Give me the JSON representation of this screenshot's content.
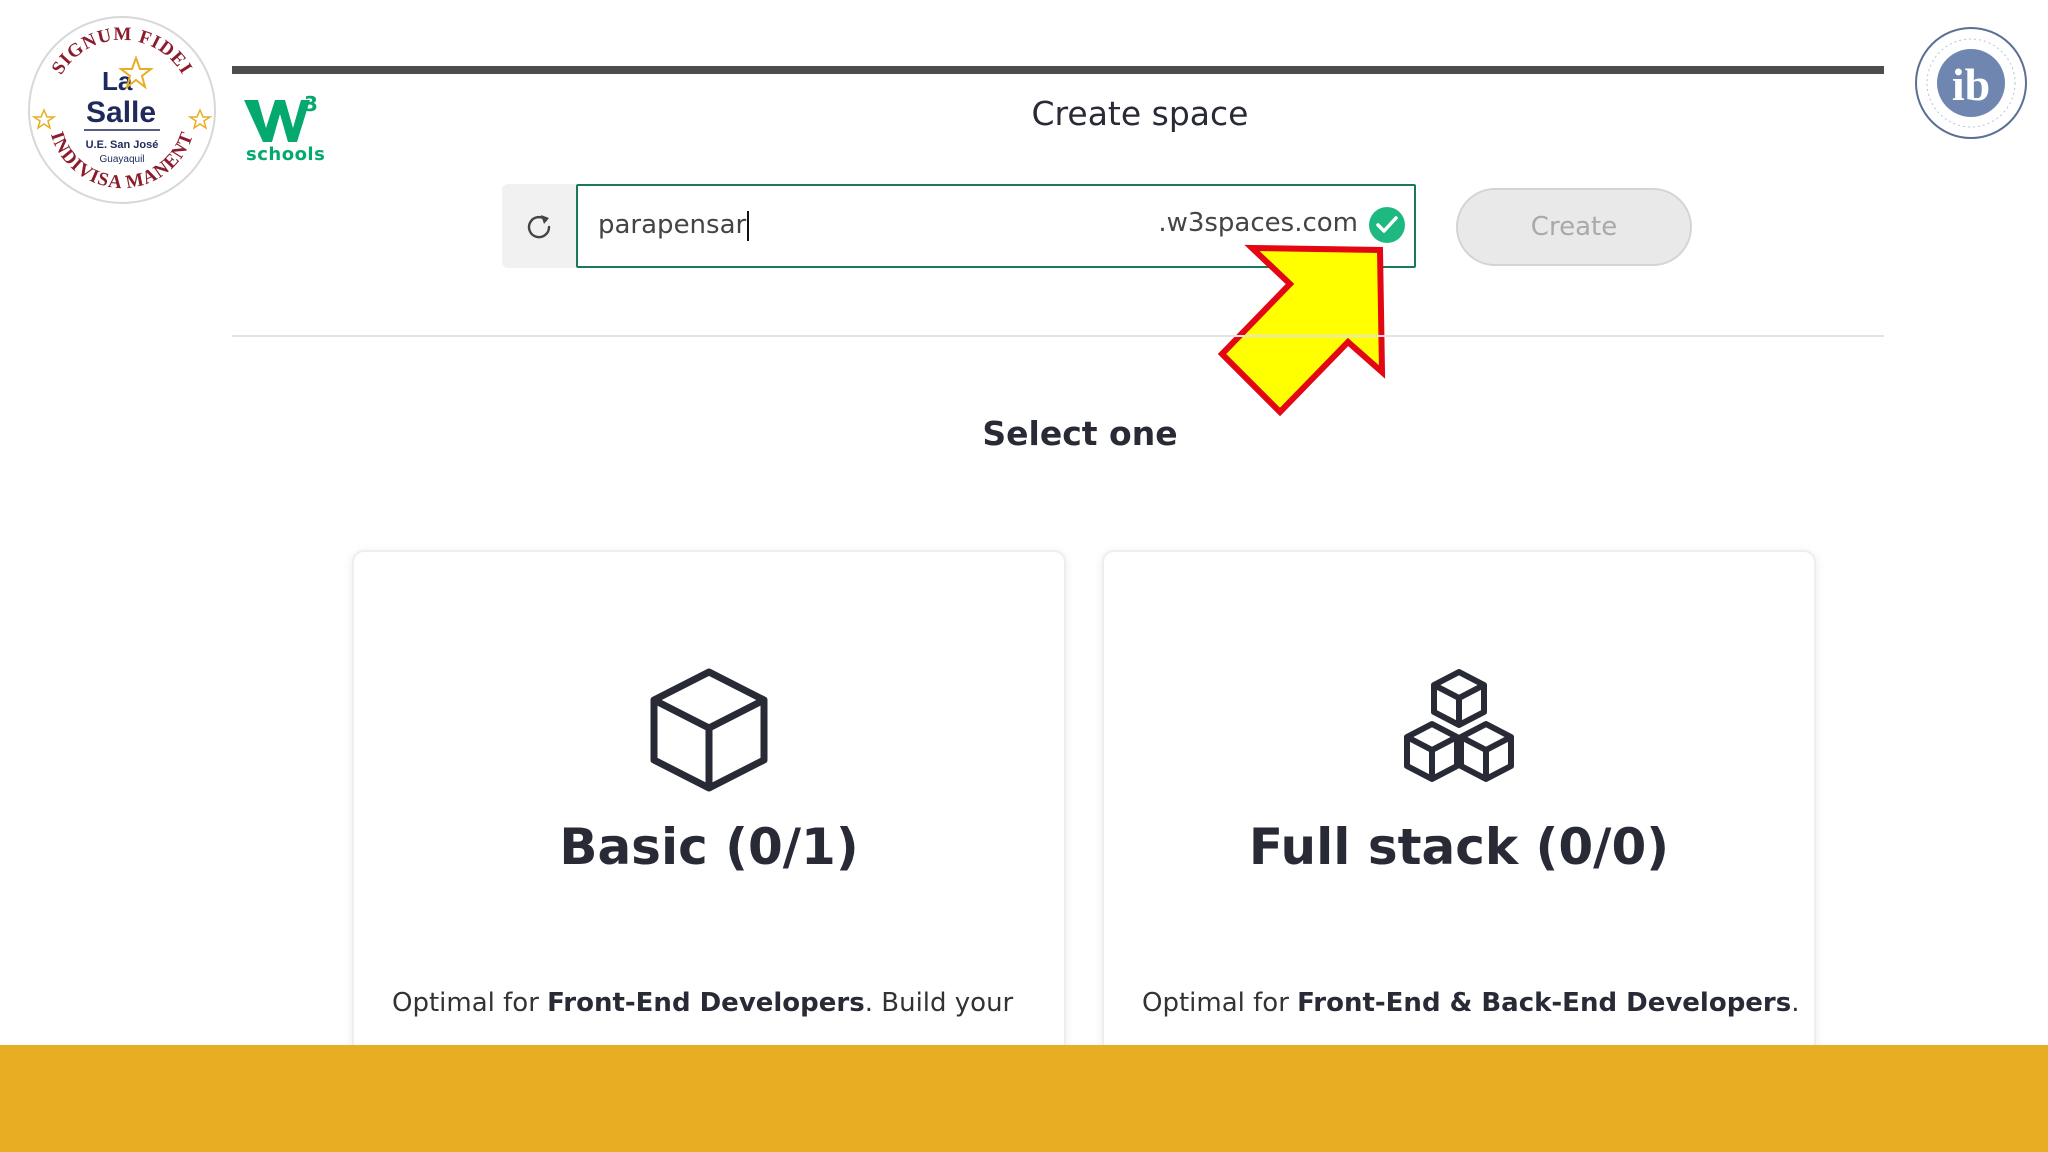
{
  "page": {
    "title": "Create space",
    "select_label": "Select one"
  },
  "colors": {
    "footer": "#e8ae23",
    "brand_green": "#04aa6d",
    "valid_check": "#1eb980",
    "arrow_fill": "#ffff00",
    "arrow_stroke": "#e30613"
  },
  "logos": {
    "school": {
      "top_arc": "SIGNUM FIDEI",
      "line1": "La",
      "line2": "Salle",
      "line3": "U.E. San José",
      "line4": "Guayaquil",
      "bottom_arc": "INDIVISA MANENT"
    },
    "w3schools": {
      "mark": "W",
      "sup": "3",
      "word": "schools"
    },
    "ib": {
      "letters": "ib"
    }
  },
  "form": {
    "domain_value": "parapensar",
    "domain_suffix": ".w3spaces.com",
    "create_label": "Create",
    "refresh_icon": "refresh-icon",
    "valid_icon": "check-circle-icon"
  },
  "cards": [
    {
      "title": "Basic (0/1)",
      "icon": "cube-icon",
      "desc_prefix": "Optimal for ",
      "desc_bold": "Front-End Developers",
      "desc_suffix": ". Build your"
    },
    {
      "title": "Full stack (0/0)",
      "icon": "cubes-icon",
      "desc_prefix": "Optimal for ",
      "desc_bold": "Front-End & Back-End Developers",
      "desc_suffix": "."
    }
  ]
}
